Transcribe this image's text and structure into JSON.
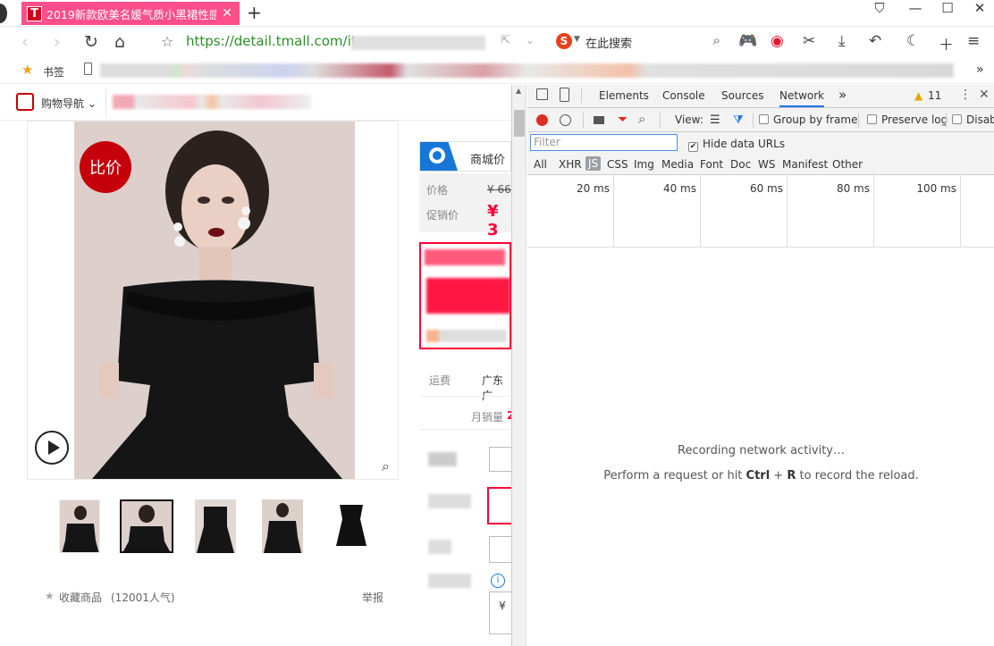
{
  "browser": {
    "tab_title": "2019新款欧美名媛气质小黑裙性感修",
    "tab_logo": "T",
    "url_host": "https://detail.tmall.com/ite",
    "search_placeholder": "在此搜索",
    "bookmark_label": "书签"
  },
  "page": {
    "nav_label": "购物导航 ⌄",
    "compare_badge": "比价",
    "mall_badge": "商城价",
    "price_label": "价格",
    "price_value": "¥ 66",
    "promo_label": "促销价",
    "promo_value": "¥ 3",
    "shipping_label": "运费",
    "shipping_value": "广东广",
    "monthly_sales_label": "月销量",
    "monthly_sales_value": "2",
    "collect_label": "收藏商品",
    "collect_count": "(12001人气)",
    "report_label": "举报"
  },
  "devtools": {
    "tabs": [
      "Elements",
      "Console",
      "Sources",
      "Network"
    ],
    "more_tabs": "»",
    "warning_count": "11",
    "view_label": "View:",
    "group_by_frame": "Group by frame",
    "preserve_log": "Preserve log",
    "disable_cache": "Disab",
    "filter_placeholder": "Filter",
    "hide_data_urls": "Hide data URLs",
    "type_filters": [
      "All",
      "XHR",
      "JS",
      "CSS",
      "Img",
      "Media",
      "Font",
      "Doc",
      "WS",
      "Manifest",
      "Other"
    ],
    "timeline_ticks": [
      "20 ms",
      "40 ms",
      "60 ms",
      "80 ms",
      "100 ms"
    ],
    "recording_msg": "Recording network activity…",
    "reload_prefix": "Perform a request or hit ",
    "reload_key1": "Ctrl",
    "reload_plus": " + ",
    "reload_key2": "R",
    "reload_suffix": " to record the reload."
  },
  "colors": {
    "tab_bg": "#ff4f8a",
    "tmall_red": "#c6000b",
    "url_green": "#2a8f2a",
    "devtools_active": "#1a73e8",
    "record_red": "#d93025"
  }
}
